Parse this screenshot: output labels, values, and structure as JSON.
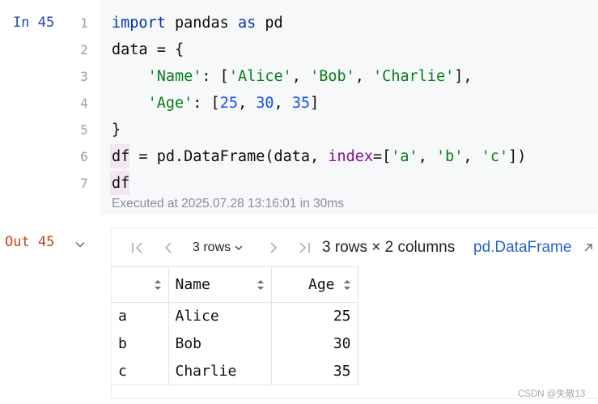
{
  "input": {
    "prompt": "In 45",
    "line_numbers": [
      "1",
      "2",
      "3",
      "4",
      "5",
      "6",
      "7"
    ],
    "executed": "Executed at 2025.07.28 13:16:01 in 30ms"
  },
  "output": {
    "prompt": "Out 45",
    "toolbar": {
      "rows_select": "3 rows",
      "summary": "3 rows × 2 columns",
      "type_link": "pd.DataFrame"
    },
    "table": {
      "columns": [
        "Name",
        "Age"
      ],
      "rows": [
        {
          "index": "a",
          "name": "Alice",
          "age": "25"
        },
        {
          "index": "b",
          "name": "Bob",
          "age": "30"
        },
        {
          "index": "c",
          "name": "Charlie",
          "age": "35"
        }
      ]
    }
  },
  "watermark": "CSDN @失散13",
  "colors": {
    "keyword": "#0033b3",
    "string": "#067d17",
    "number": "#1750eb",
    "param": "#871094",
    "in_prompt": "#2447a8",
    "out_prompt": "#c1441c",
    "link": "#2a63c4"
  }
}
